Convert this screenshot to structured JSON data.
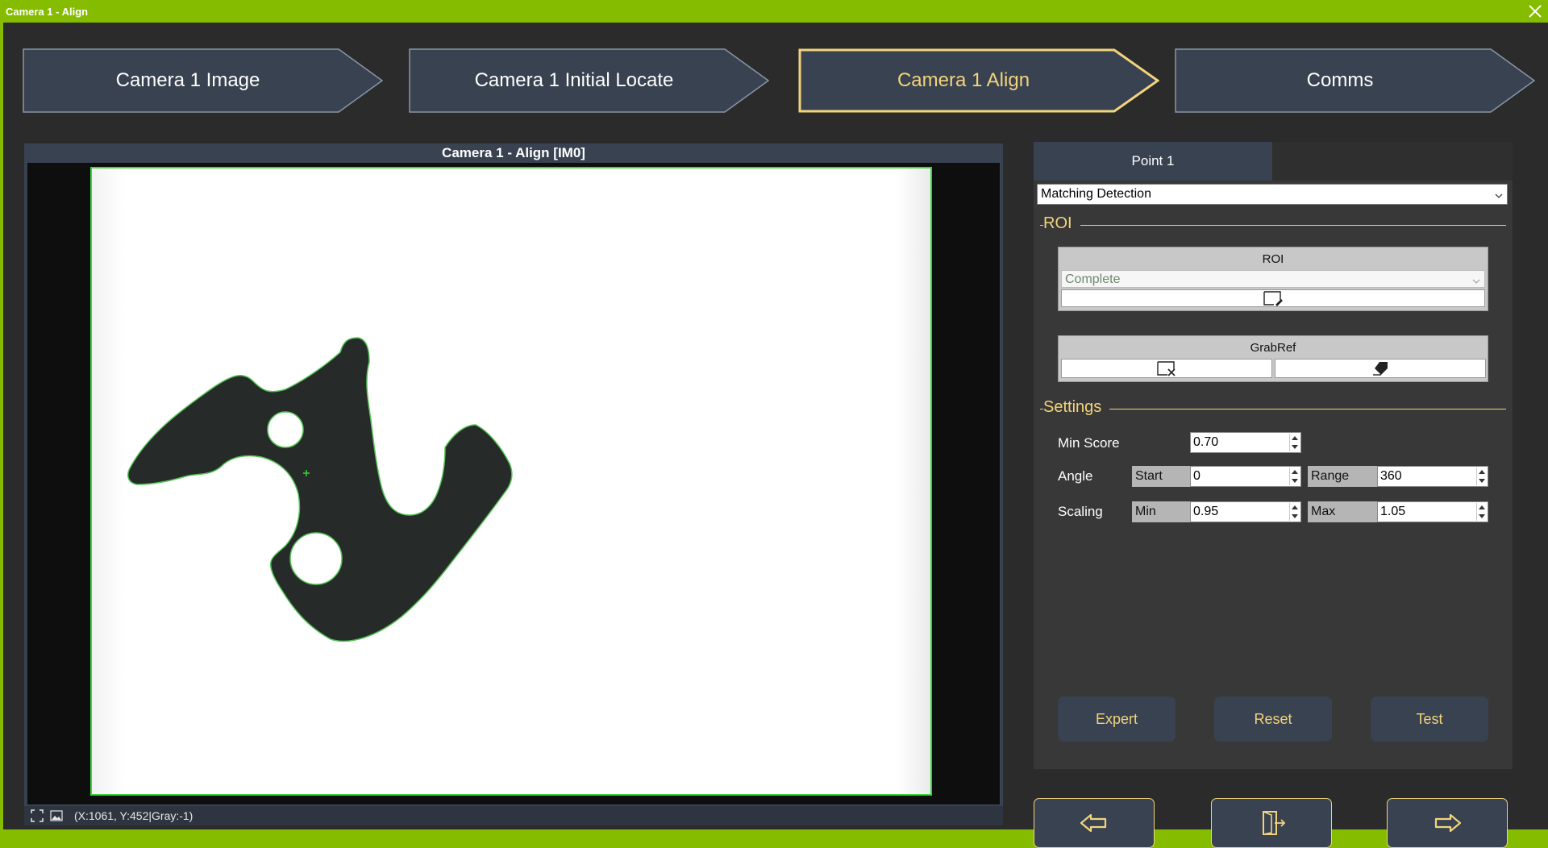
{
  "window": {
    "title": "Camera 1 - Align",
    "title_bar_color": "#86bc00",
    "close_icon": "close-icon"
  },
  "steps": [
    {
      "label": "Camera 1 Image",
      "active": false
    },
    {
      "label": "Camera 1 Initial Locate",
      "active": false
    },
    {
      "label": "Camera 1 Align",
      "active": true
    },
    {
      "label": "Comms",
      "active": false
    }
  ],
  "image_panel": {
    "title": "Camera 1 - Align  [IM0]",
    "status": "(X:1061, Y:452|Gray:-1)",
    "status_icons": [
      "fit-view-icon",
      "image-icon"
    ]
  },
  "right_panel": {
    "tabs": [
      {
        "label": "Point 1",
        "active": true
      }
    ],
    "mode_select": {
      "value": "Matching Detection"
    },
    "roi_section": {
      "title": "ROI",
      "group_title": "ROI",
      "roi_select": {
        "value": "Complete"
      },
      "edit_icon": "edit-roi-icon"
    },
    "grabref": {
      "title": "GrabRef",
      "icons": [
        "grab-reference-icon",
        "clear-reference-icon"
      ]
    },
    "settings_section": {
      "title": "Settings",
      "min_score": {
        "label": "Min Score",
        "value": "0.70"
      },
      "angle": {
        "label": "Angle",
        "start_label": "Start",
        "start_value": "0",
        "range_label": "Range",
        "range_value": "360"
      },
      "scaling": {
        "label": "Scaling",
        "min_label": "Min",
        "min_value": "0.95",
        "max_label": "Max",
        "max_value": "1.05"
      }
    },
    "buttons": {
      "expert": "Expert",
      "reset": "Reset",
      "test": "Test"
    }
  },
  "nav": {
    "icons": [
      "arrow-left-icon",
      "exit-icon",
      "arrow-right-icon"
    ]
  },
  "colors": {
    "accent": "#f3d47c",
    "panel": "#384250",
    "background": "#2b2b2b",
    "roi_outline": "#3dd43d"
  }
}
